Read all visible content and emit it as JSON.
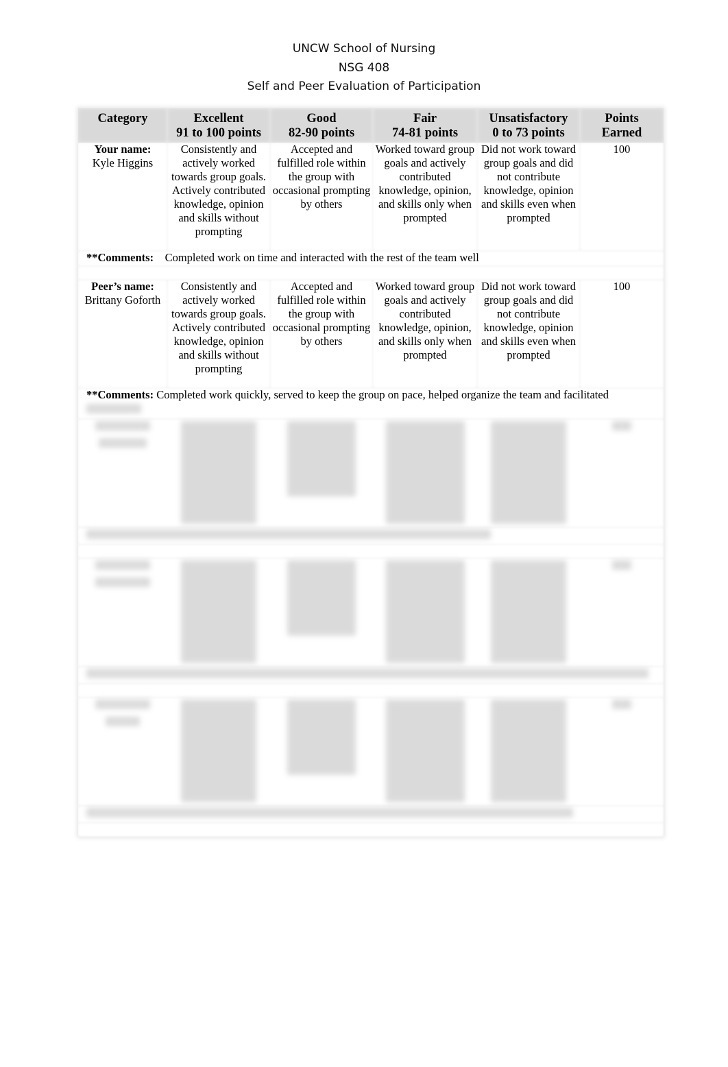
{
  "header": {
    "institution": "UNCW School of Nursing",
    "course": "NSG 408",
    "title": "Self and Peer Evaluation of Participation"
  },
  "table": {
    "columns": [
      {
        "name": "Category",
        "range": ""
      },
      {
        "name": "Excellent",
        "range": "91 to 100 points"
      },
      {
        "name": "Good",
        "range": "82-90 points"
      },
      {
        "name": "Fair",
        "range": "74-81 points"
      },
      {
        "name": "Unsatisfactory",
        "range": "0 to 73 points"
      },
      {
        "name": "Points",
        "range": "Earned"
      }
    ],
    "criteria": {
      "excellent": "Consistently and actively worked towards group goals.  Actively contributed knowledge, opinion and skills without prompting",
      "good": "Accepted and fulfilled role within the group with occasional prompting by others",
      "fair": "Worked toward group goals and actively contributed knowledge, opinion, and skills only when prompted",
      "unsatisfactory": "Did not work toward group goals and did not contribute knowledge, opinion and skills even when prompted"
    },
    "comment_label": "**Comments:",
    "evaluations": [
      {
        "label": "Your name:",
        "name": "Kyle Higgins",
        "points": "100",
        "comment": "Completed work on time and interacted with the rest of the team well",
        "blurred": false
      },
      {
        "label": "Peer’s name:",
        "name": "Brittany Goforth",
        "points": "100",
        "comment": "Completed work quickly, served to keep the group on pace, helped organize the team and facilitated",
        "comment_continued": "",
        "blurred": false
      },
      {
        "label": "",
        "name": "",
        "points": "",
        "comment": "",
        "blurred": true
      },
      {
        "label": "",
        "name": "",
        "points": "",
        "comment": "",
        "blurred": true
      },
      {
        "label": "",
        "name": "",
        "points": "",
        "comment": "",
        "blurred": true
      }
    ]
  }
}
